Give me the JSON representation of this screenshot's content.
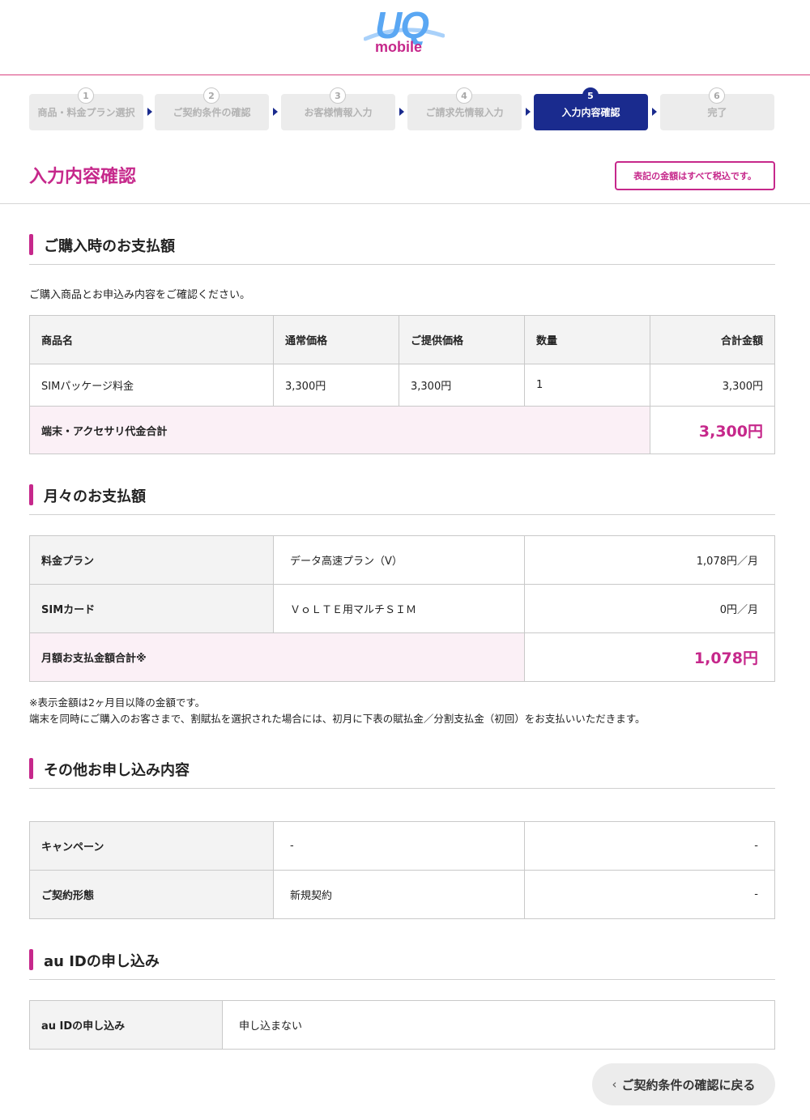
{
  "brand": {
    "logo_top": "UQ",
    "logo_bottom": "mobile",
    "accent": "#c6288b",
    "navy": "#1a2b8e",
    "sky": "#5aa7f3"
  },
  "steps": [
    {
      "num": "1",
      "label": "商品・料金プラン選択",
      "active": false
    },
    {
      "num": "2",
      "label": "ご契約条件の確認",
      "active": false
    },
    {
      "num": "3",
      "label": "お客様情報入力",
      "active": false
    },
    {
      "num": "4",
      "label": "ご請求先情報入力",
      "active": false
    },
    {
      "num": "5",
      "label": "入力内容確認",
      "active": true
    },
    {
      "num": "6",
      "label": "完了",
      "active": false
    }
  ],
  "page": {
    "title": "入力内容確認",
    "tax_note": "表記の金額はすべて税込です。"
  },
  "purchase": {
    "heading": "ご購入時のお支払額",
    "description": "ご購入商品とお申込み内容をご確認ください。",
    "headers": [
      "商品名",
      "通常価格",
      "ご提供価格",
      "数量",
      "合計金額"
    ],
    "row": [
      "SIMパッケージ料金",
      "3,300円",
      "3,300円",
      "1",
      "3,300円"
    ],
    "total_label": "端末・アクセサリ代金合計",
    "total_value": "3,300円"
  },
  "monthly": {
    "heading": "月々のお支払額",
    "rows": [
      {
        "label": "料金プラン",
        "value": "データ高速プラン（V）",
        "price": "1,078円／月"
      },
      {
        "label": "SIMカード",
        "value": "ＶｏＬＴＥ用マルチＳＩＭ",
        "price": "0円／月"
      }
    ],
    "total_label": "月額お支払金額合計※",
    "total_value": "1,078円",
    "note1": "※表示金額は2ヶ月目以降の金額です。",
    "note2": "端末を同時にご購入のお客さまで、割賦払を選択された場合には、初月に下表の賦払金／分割支払金（初回）をお支払いいただきます。"
  },
  "other": {
    "heading": "その他お申し込み内容",
    "rows": [
      {
        "label": "キャンペーン",
        "value": "-",
        "extra": "-"
      },
      {
        "label": "ご契約形態",
        "value": "新規契約",
        "extra": "-"
      }
    ]
  },
  "auid": {
    "heading": "au IDの申し込み",
    "label": "au IDの申し込み",
    "value": "申し込まない"
  },
  "back_button": {
    "label": "ご契約条件の確認に戻る",
    "icon": "chevron-left-icon"
  }
}
